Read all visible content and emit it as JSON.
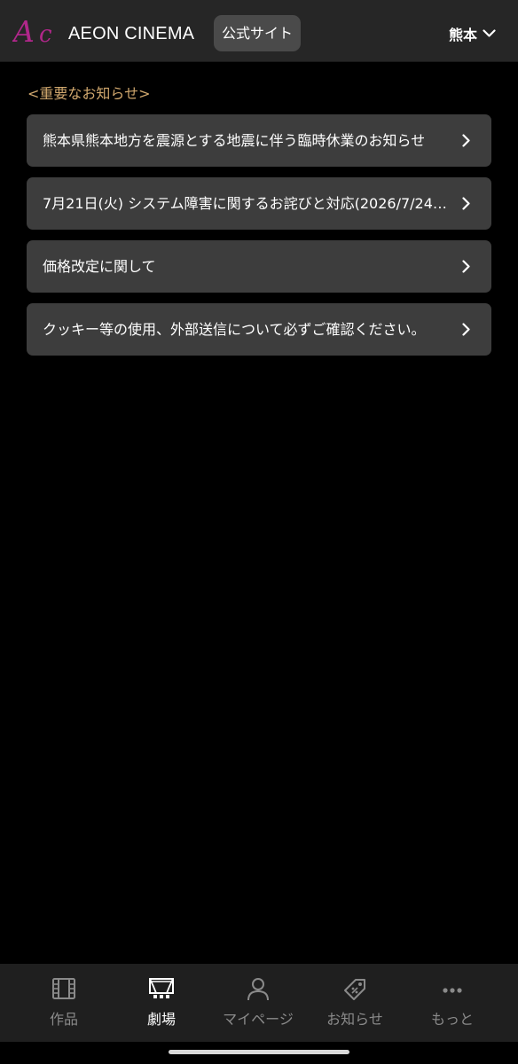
{
  "header": {
    "logo_text": "AEON CINEMA",
    "official_site_label": "公式サイト",
    "region_label": "熊本"
  },
  "notices": {
    "section_title": "<重要なお知らせ>",
    "items": [
      {
        "text": "熊本県熊本地方を震源とする地震に伴う臨時休業のお知らせ"
      },
      {
        "text": "7月21日(火) システム障害に関するお詫びと対応(2026/7/24更…"
      },
      {
        "text": "価格改定に関して"
      },
      {
        "text": "クッキー等の使用、外部送信について必ずご確認ください。"
      }
    ]
  },
  "tabbar": {
    "tabs": [
      {
        "label": "作品",
        "icon": "film-icon",
        "active": false
      },
      {
        "label": "劇場",
        "icon": "theater-icon",
        "active": true
      },
      {
        "label": "マイページ",
        "icon": "person-icon",
        "active": false
      },
      {
        "label": "お知らせ",
        "icon": "tag-icon",
        "active": false
      },
      {
        "label": "もっと",
        "icon": "more-icon",
        "active": false
      }
    ]
  },
  "colors": {
    "brand_magenta": "#b0278a",
    "section_title_gold": "#d1a86e",
    "notice_background": "#3d3d3d",
    "header_background": "#262626",
    "tabbar_background": "#1f1f1f",
    "tab_inactive": "#8a8a8a",
    "tab_active": "#ffffff"
  }
}
